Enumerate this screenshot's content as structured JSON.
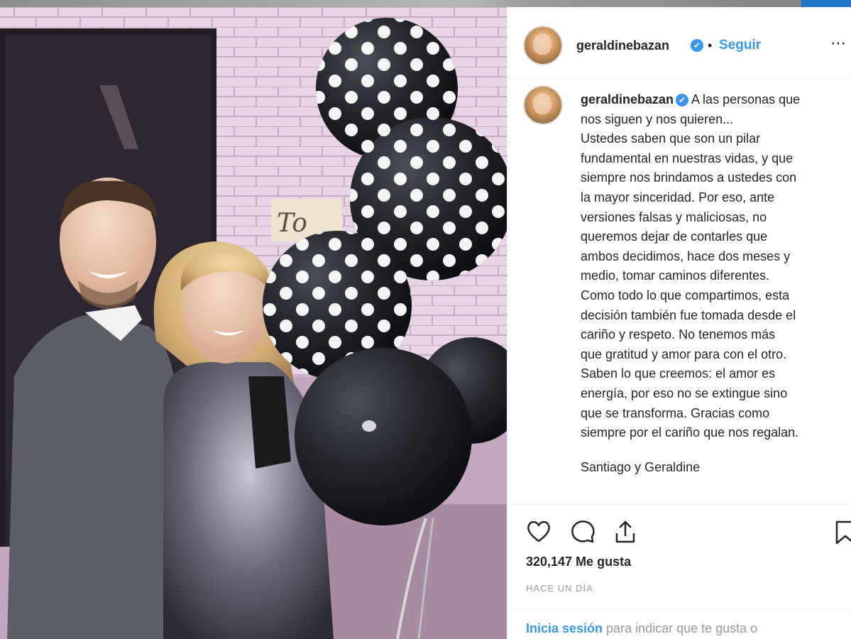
{
  "post": {
    "username": "geraldinebazan",
    "verified_mark": "✔",
    "separator": "•",
    "follow_label": "Seguir",
    "more_icon": "more-options-icon",
    "caption": {
      "username": "geraldinebazan",
      "text_first": "A las personas que",
      "text_rest": "nos siguen y nos quieren...\nUstedes saben que son un pilar\nfundamental en nuestras vidas, y que\nsiempre nos brindamos a ustedes con\nla mayor sinceridad. Por eso, ante\nversiones falsas y maliciosas, no\nqueremos dejar de contarles que\nambos decidimos, hace dos meses y\nmedio, tomar caminos diferentes.\nComo todo lo que compartimos, esta\ndecisión también fue tomada desde el\ncariño y respeto. No tenemos más\nque gratitud y amor para con el otro.\nSaben lo que creemos: el amor es\nenergía, por eso no se extingue sino\nque se transforma. Gracias como\nsiempre por el cariño que nos regalan.",
      "signature": "Santiago y Geraldine"
    },
    "likes": "320,147 Me gusta",
    "time": "HACE UN DÍA",
    "login_link": "Inicia sesión",
    "login_rest": " para indicar que te gusta o",
    "icons": [
      "heart-icon",
      "comment-icon",
      "share-icon",
      "bookmark-icon"
    ],
    "colors": {
      "accent": "#3897f0",
      "text": "#262626",
      "muted": "#999999"
    }
  },
  "photo": {
    "sign_text": "To"
  }
}
